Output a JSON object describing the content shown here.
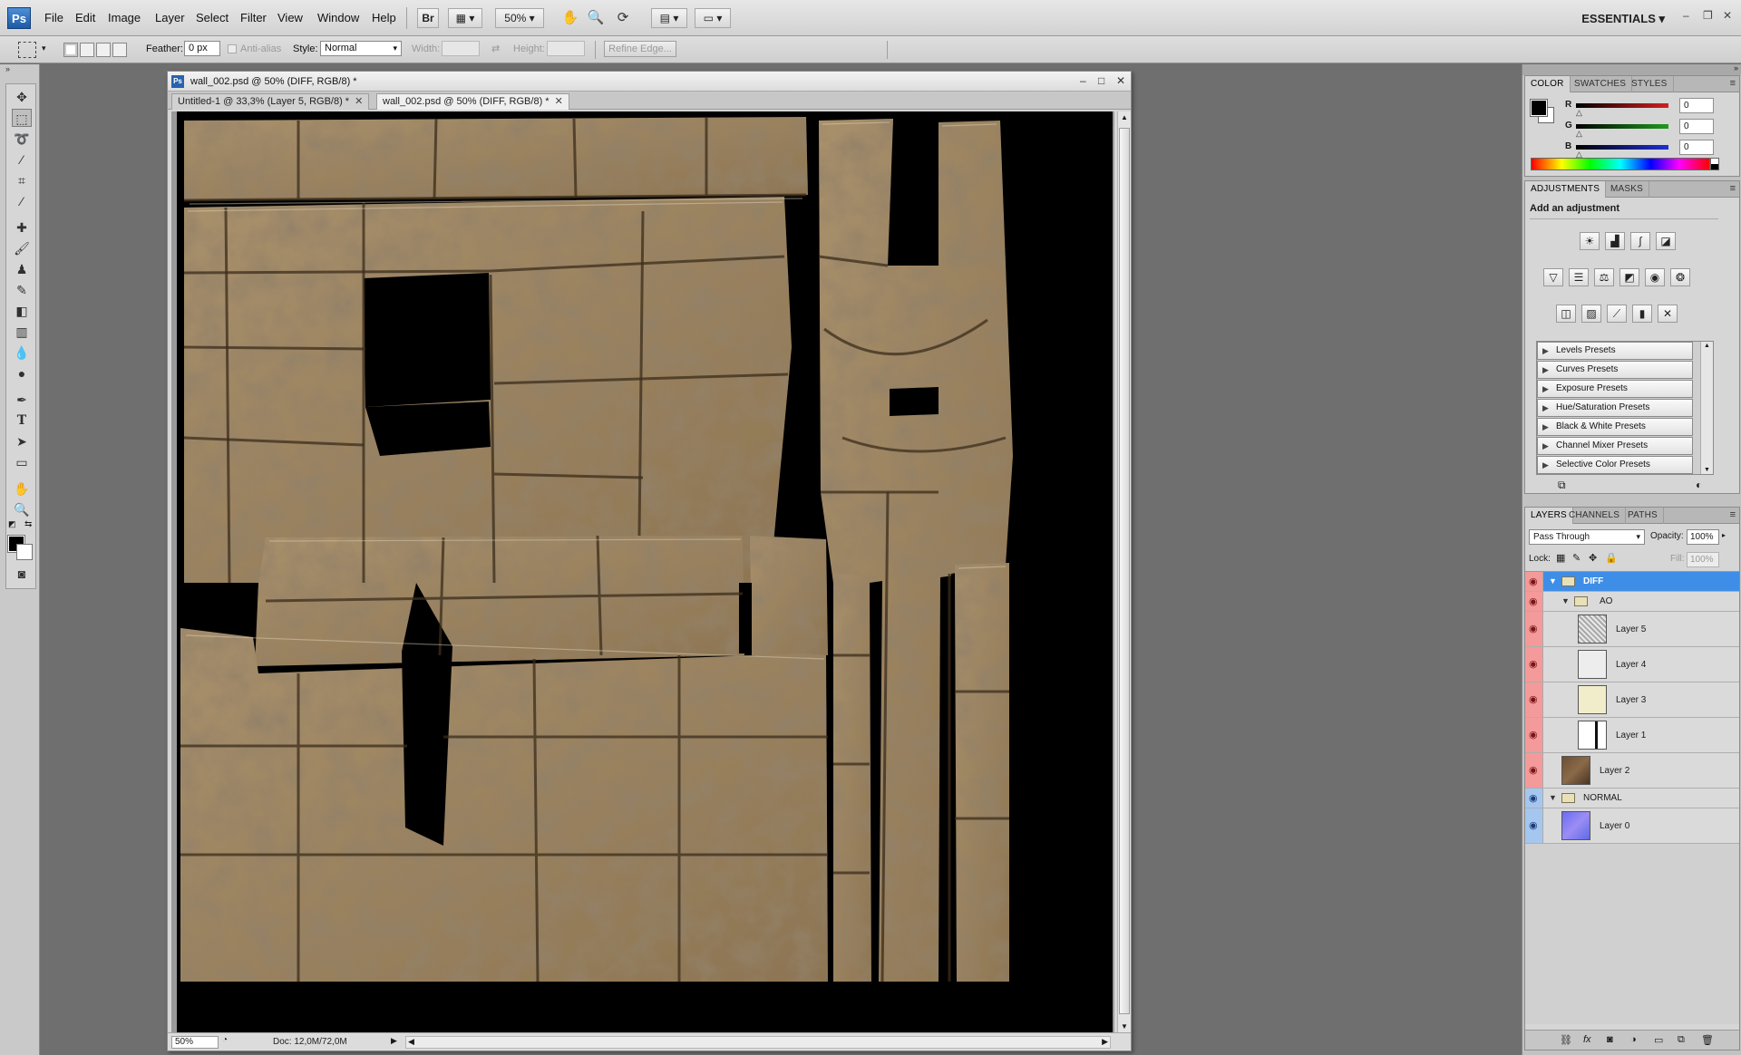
{
  "app": {
    "logo": "Ps",
    "workspace": "ESSENTIALS"
  },
  "menu": [
    "File",
    "Edit",
    "Image",
    "Layer",
    "Select",
    "Filter",
    "View",
    "Window",
    "Help"
  ],
  "menubar": {
    "bridge_label": "Br",
    "zoom": "50%"
  },
  "options": {
    "feather_label": "Feather:",
    "feather_value": "0 px",
    "antialias_label": "Anti-alias",
    "style_label": "Style:",
    "style_value": "Normal",
    "width_label": "Width:",
    "height_label": "Height:",
    "refine_edge": "Refine Edge..."
  },
  "document": {
    "title": "wall_002.psd @ 50% (DIFF, RGB/8) *",
    "tabs": [
      {
        "label": "Untitled-1 @ 33,3% (Layer 5, RGB/8) *"
      },
      {
        "label": "wall_002.psd @ 50% (DIFF, RGB/8) *"
      }
    ],
    "zoom": "50%",
    "doc_info": "Doc: 12,0M/72,0M"
  },
  "color_panel": {
    "tabs": [
      "COLOR",
      "SWATCHES",
      "STYLES"
    ],
    "r_label": "R",
    "r_value": "0",
    "g_label": "G",
    "g_value": "0",
    "b_label": "B",
    "b_value": "0",
    "slider_colors": {
      "r": "#d41f1f",
      "g": "#1f9a1f",
      "b": "#1f2fd4"
    }
  },
  "adjustments_panel": {
    "tabs": [
      "ADJUSTMENTS",
      "MASKS"
    ],
    "heading": "Add an adjustment",
    "presets": [
      "Levels Presets",
      "Curves Presets",
      "Exposure Presets",
      "Hue/Saturation Presets",
      "Black & White Presets",
      "Channel Mixer Presets",
      "Selective Color Presets"
    ]
  },
  "layers_panel": {
    "tabs": [
      "LAYERS",
      "CHANNELS",
      "PATHS"
    ],
    "blend_mode": "Pass Through",
    "opacity_label": "Opacity:",
    "opacity_value": "100%",
    "lock_label": "Lock:",
    "fill_label": "Fill:",
    "fill_value": "100%",
    "layers": [
      {
        "name": "DIFF",
        "kind": "group"
      },
      {
        "name": "AO",
        "kind": "group"
      },
      {
        "name": "Layer 5",
        "kind": "layer"
      },
      {
        "name": "Layer 4",
        "kind": "layer"
      },
      {
        "name": "Layer 3",
        "kind": "layer"
      },
      {
        "name": "Layer 1",
        "kind": "layer"
      },
      {
        "name": "Layer 2",
        "kind": "layer"
      },
      {
        "name": "NORMAL",
        "kind": "group"
      },
      {
        "name": "Layer 0",
        "kind": "layer"
      }
    ]
  }
}
